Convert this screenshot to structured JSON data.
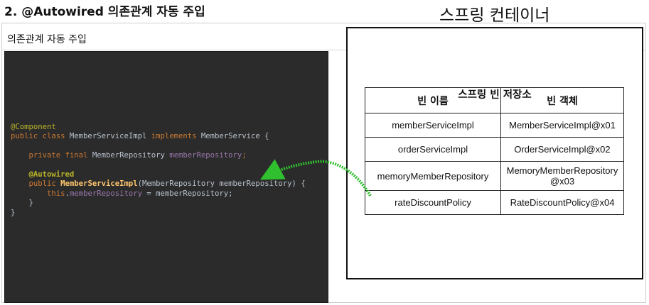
{
  "heading": "2. @Autowired 의존관계 자동 주입",
  "slide_title": "의존관계 자동 주입",
  "container_title": "스프링 컨테이너",
  "store_title": "스프링 빈 저장소",
  "table": {
    "headers": [
      "빈 이름",
      "빈 객체"
    ],
    "rows": [
      [
        "memberServiceImpl",
        "MemberServiceImpl@x01"
      ],
      [
        "orderServiceImpl",
        "OrderServiceImpl@x02"
      ],
      [
        "memoryMemberRepository",
        "MemoryMemberRepository\n@x03"
      ],
      [
        "rateDiscountPolicy",
        "RateDiscountPolicy@x04"
      ]
    ]
  },
  "code": {
    "l1": "@Component",
    "l2_kw": "public class",
    "l2_name": " MemberServiceImpl ",
    "l2_impl": "implements",
    "l2_rest": " MemberService {",
    "l3_kw": "    private final",
    "l3_type": " MemberRepository ",
    "l3_field": "memberRepository",
    "l3_end": ";",
    "l4": "    @Autowired",
    "l5_kw": "    public ",
    "l5_fn": "MemberServiceImpl",
    "l5_rest": "(MemberRepository memberRepository) {",
    "l6_kw": "        this",
    "l6_dot": ".",
    "l6_field": "memberRepository",
    "l6_rest": " = memberRepository;",
    "l7": "    }",
    "l8": "}"
  },
  "colors": {
    "code_background": "#2b2b2b",
    "annotation": "#bbb529",
    "keyword": "#cc7832",
    "field": "#9876aa",
    "method": "#ffc66d",
    "arrow": "#2fbf2f"
  }
}
